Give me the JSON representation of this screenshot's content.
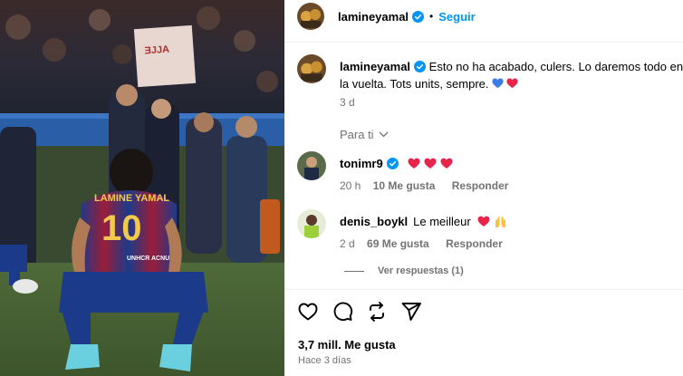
{
  "post": {
    "author": "lamineyamal",
    "follow_label": "Seguir",
    "dot": "•"
  },
  "caption": {
    "author": "lamineyamal",
    "line1": "Esto no ha acabado, culers. Lo daremos todo en",
    "line2": "la vuelta. Tots units, sempre.",
    "time": "3 d"
  },
  "sort": {
    "label": "Para ti"
  },
  "comments": [
    {
      "author": "tonimr9",
      "verified": true,
      "body": "",
      "emojis": [
        "red-heart",
        "red-heart",
        "red-heart"
      ],
      "time": "20 h",
      "likes": "10 Me gusta",
      "reply": "Responder"
    },
    {
      "author": "denis_boykl",
      "verified": false,
      "body": "Le meilleur",
      "emojis": [
        "red-heart",
        "raised-hands"
      ],
      "time": "2 d",
      "likes": "69 Me gusta",
      "reply": "Responder"
    }
  ],
  "view_replies": "Ver respuestas (1)",
  "stats": {
    "likes": "3,7 mill. Me gusta",
    "posted": "Hace 3 días"
  },
  "jersey": {
    "name": "LAMINE YAMAL",
    "number": "10",
    "sponsor": "UNHCR ACNUR"
  },
  "colors": {
    "follow": "#0095f6",
    "verified": "#0095f6",
    "heart": "#ff3040",
    "muted": "#737373"
  }
}
